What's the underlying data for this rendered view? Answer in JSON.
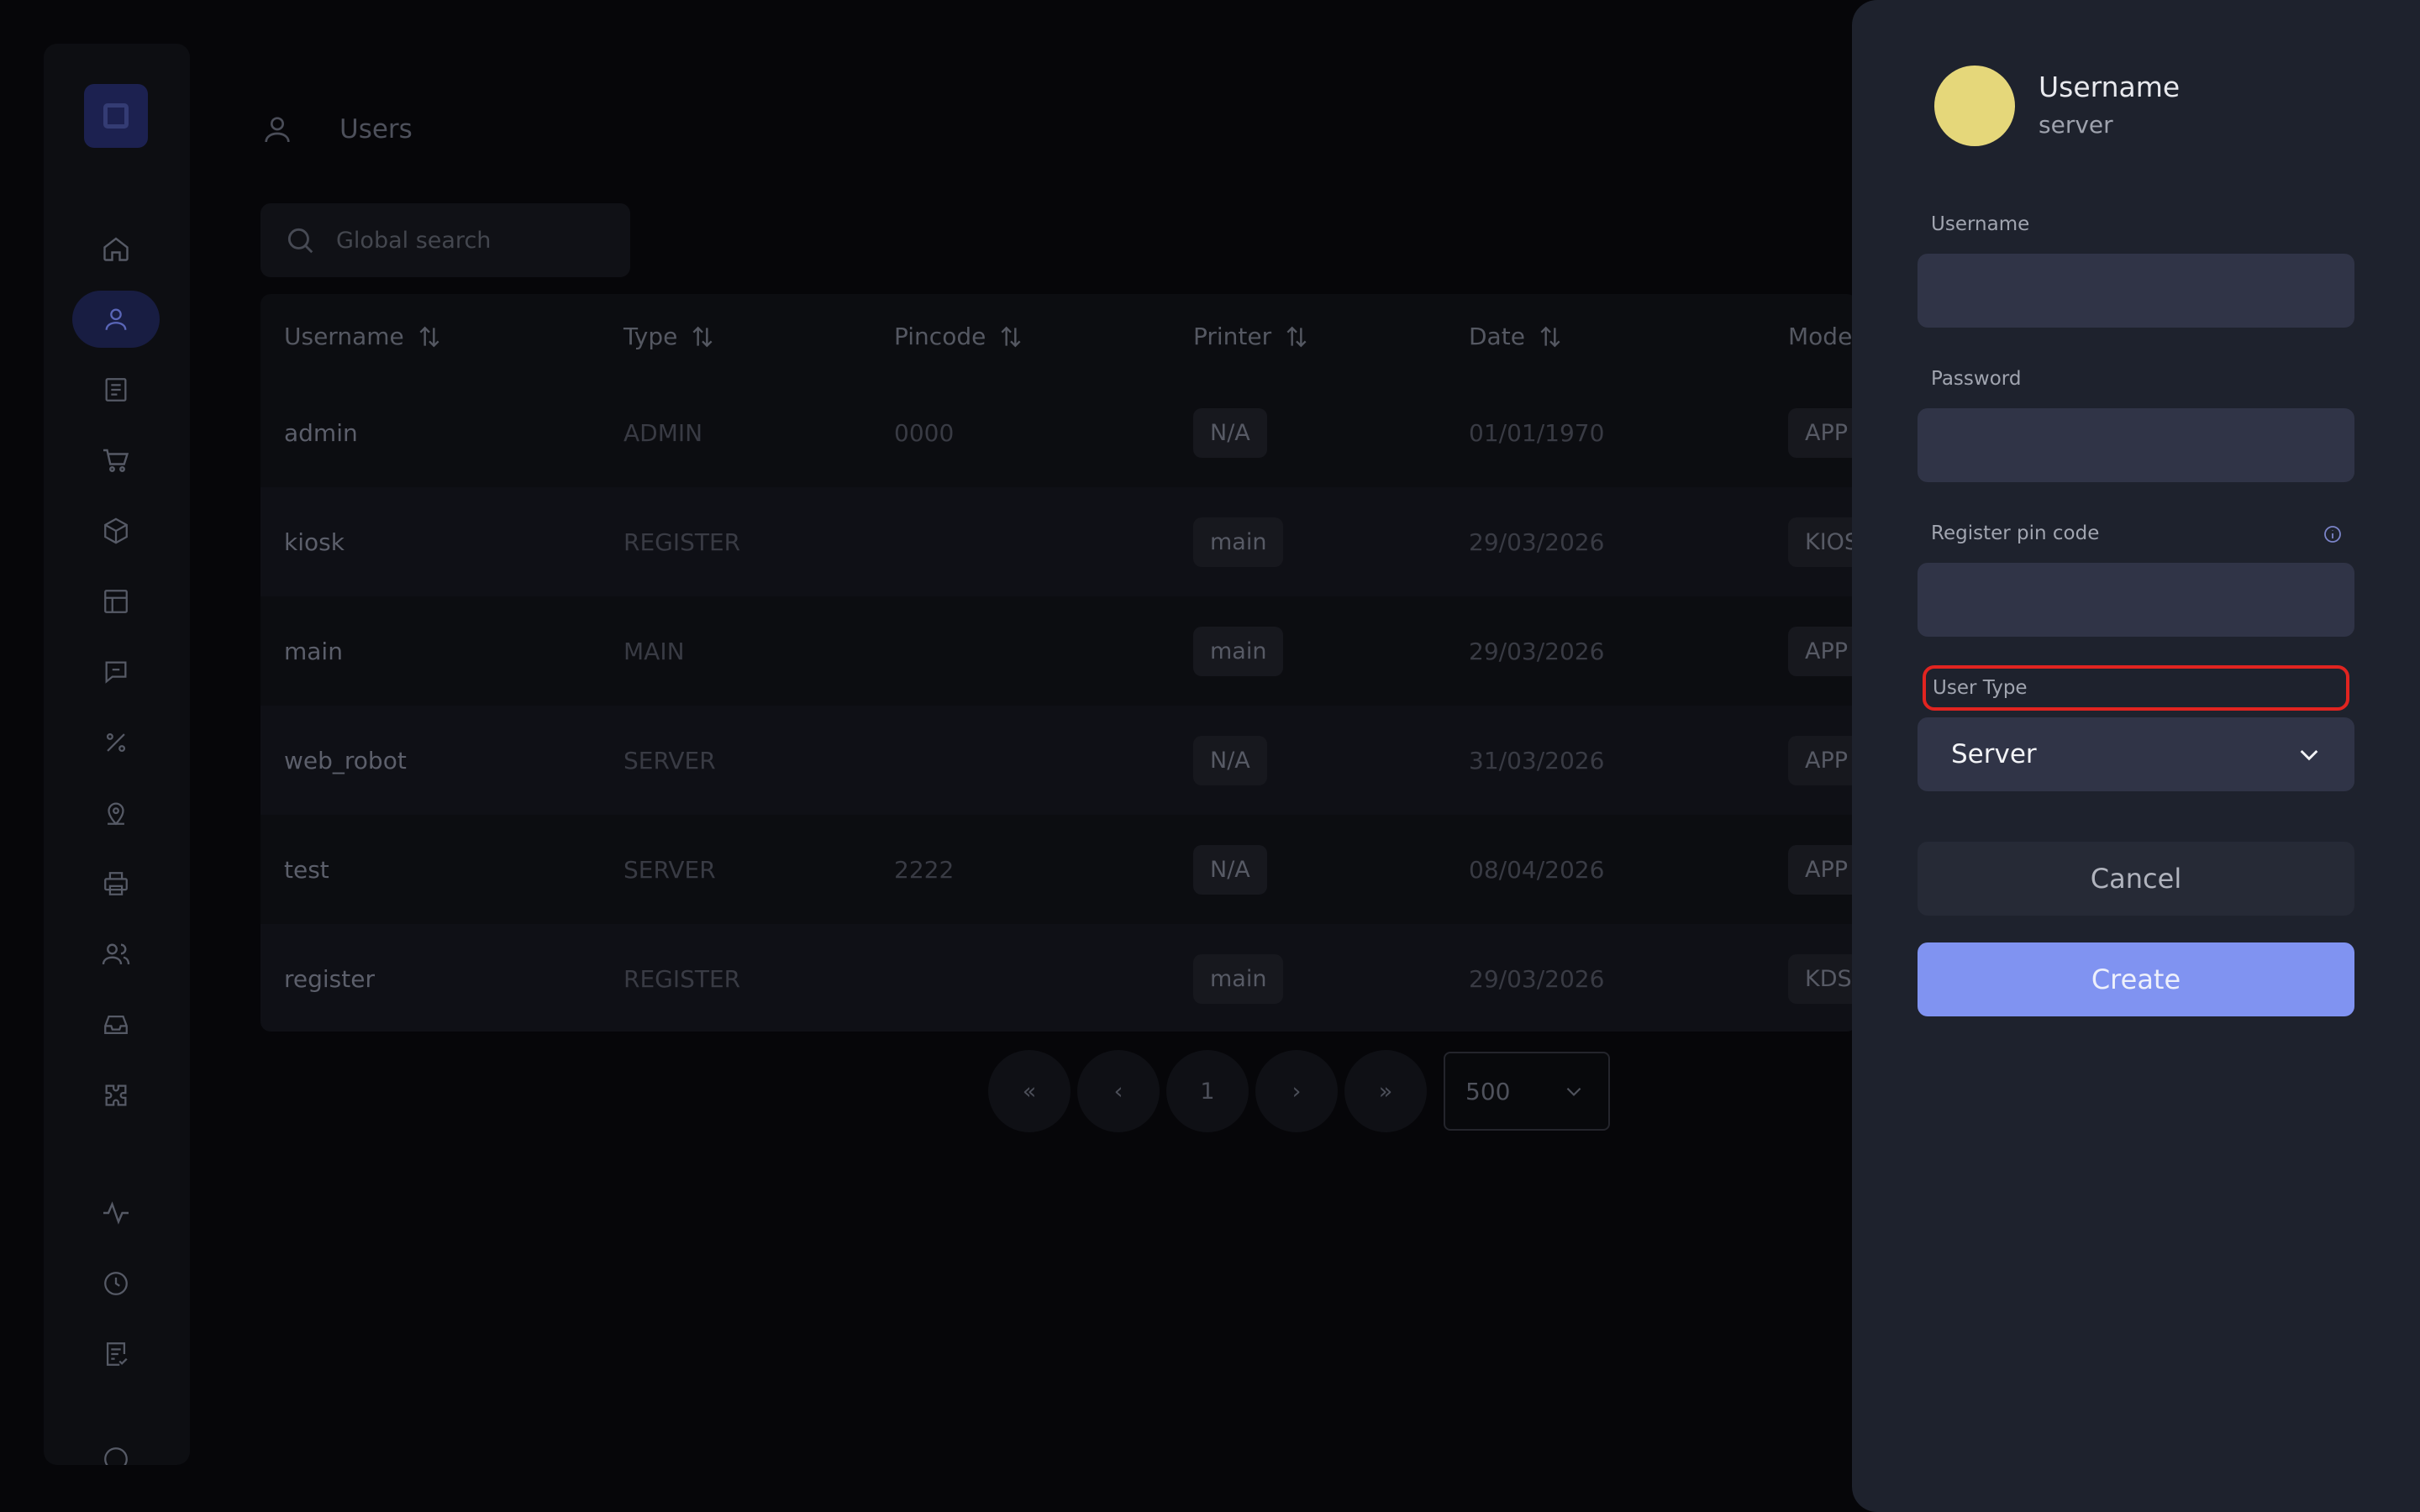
{
  "page": {
    "title": "Users"
  },
  "search": {
    "placeholder": "Global search"
  },
  "table": {
    "columns": [
      "Username",
      "Type",
      "Pincode",
      "Printer",
      "Date",
      "Mode"
    ],
    "rows": [
      {
        "username": "admin",
        "type": "ADMIN",
        "pincode": "0000",
        "printer": "N/A",
        "date": "01/01/1970",
        "mode": "APP"
      },
      {
        "username": "kiosk",
        "type": "REGISTER",
        "pincode": "",
        "printer": "main",
        "date": "29/03/2026",
        "mode": "KIOS"
      },
      {
        "username": "main",
        "type": "MAIN",
        "pincode": "",
        "printer": "main",
        "date": "29/03/2026",
        "mode": "APP"
      },
      {
        "username": "web_robot",
        "type": "SERVER",
        "pincode": "",
        "printer": "N/A",
        "date": "31/03/2026",
        "mode": "APP"
      },
      {
        "username": "test",
        "type": "SERVER",
        "pincode": "2222",
        "printer": "N/A",
        "date": "08/04/2026",
        "mode": "APP"
      },
      {
        "username": "register",
        "type": "REGISTER",
        "pincode": "",
        "printer": "main",
        "date": "29/03/2026",
        "mode": "KDS"
      }
    ]
  },
  "pagination": {
    "first": "«",
    "prev": "‹",
    "current": "1",
    "next": "›",
    "last": "»",
    "page_size": "500"
  },
  "drawer": {
    "name": "Username",
    "subtitle": "server",
    "avatar_color": "#e5d77a",
    "fields": {
      "username_label": "Username",
      "username_value": "",
      "password_label": "Password",
      "password_value": "",
      "pin_label": "Register pin code",
      "pin_value": "",
      "user_type_label": "User Type",
      "user_type_value": "Server"
    },
    "cancel_label": "Cancel",
    "create_label": "Create",
    "create_color": "#8093f1",
    "highlight_color": "#e12420"
  },
  "sidebar": {
    "icons": [
      "logo-icon",
      "home-icon",
      "user-icon",
      "document-icon",
      "cart-icon",
      "box-icon",
      "table-icon",
      "message-icon",
      "percent-icon",
      "location-icon",
      "printer-icon",
      "users-icon",
      "inbox-icon",
      "puzzle-icon",
      "activity-icon",
      "clock-icon",
      "checklist-icon",
      "help-icon"
    ],
    "active": "user-icon"
  }
}
